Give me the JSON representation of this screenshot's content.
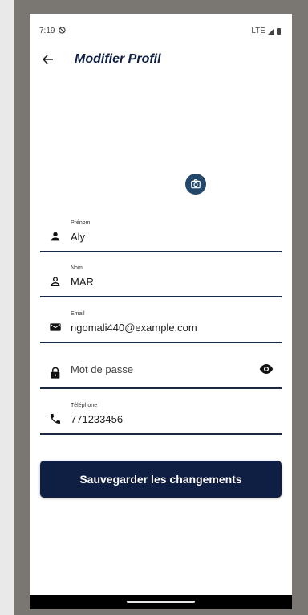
{
  "status_bar": {
    "time": "7:19",
    "network": "LTE"
  },
  "app_bar": {
    "title": "Modifier Profil",
    "back_icon": "arrow-left-icon"
  },
  "avatar": {
    "camera_icon": "camera-icon",
    "accent_color": "#22476b"
  },
  "form": {
    "first_name": {
      "label": "Prénom",
      "value": "Aly",
      "icon": "person-filled-icon"
    },
    "last_name": {
      "label": "Nom",
      "value": "MAR",
      "icon": "person-outline-icon"
    },
    "email": {
      "label": "Email",
      "value": "ngomali440@example.com",
      "icon": "mail-icon"
    },
    "password": {
      "placeholder": "Mot de passe",
      "icon": "lock-icon",
      "toggle_icon": "eye-icon"
    },
    "phone": {
      "label": "Téléphone",
      "value": "771233456",
      "icon": "phone-icon"
    }
  },
  "save_button": {
    "label": "Sauvegarder les changements",
    "color": "#0f1f44"
  }
}
